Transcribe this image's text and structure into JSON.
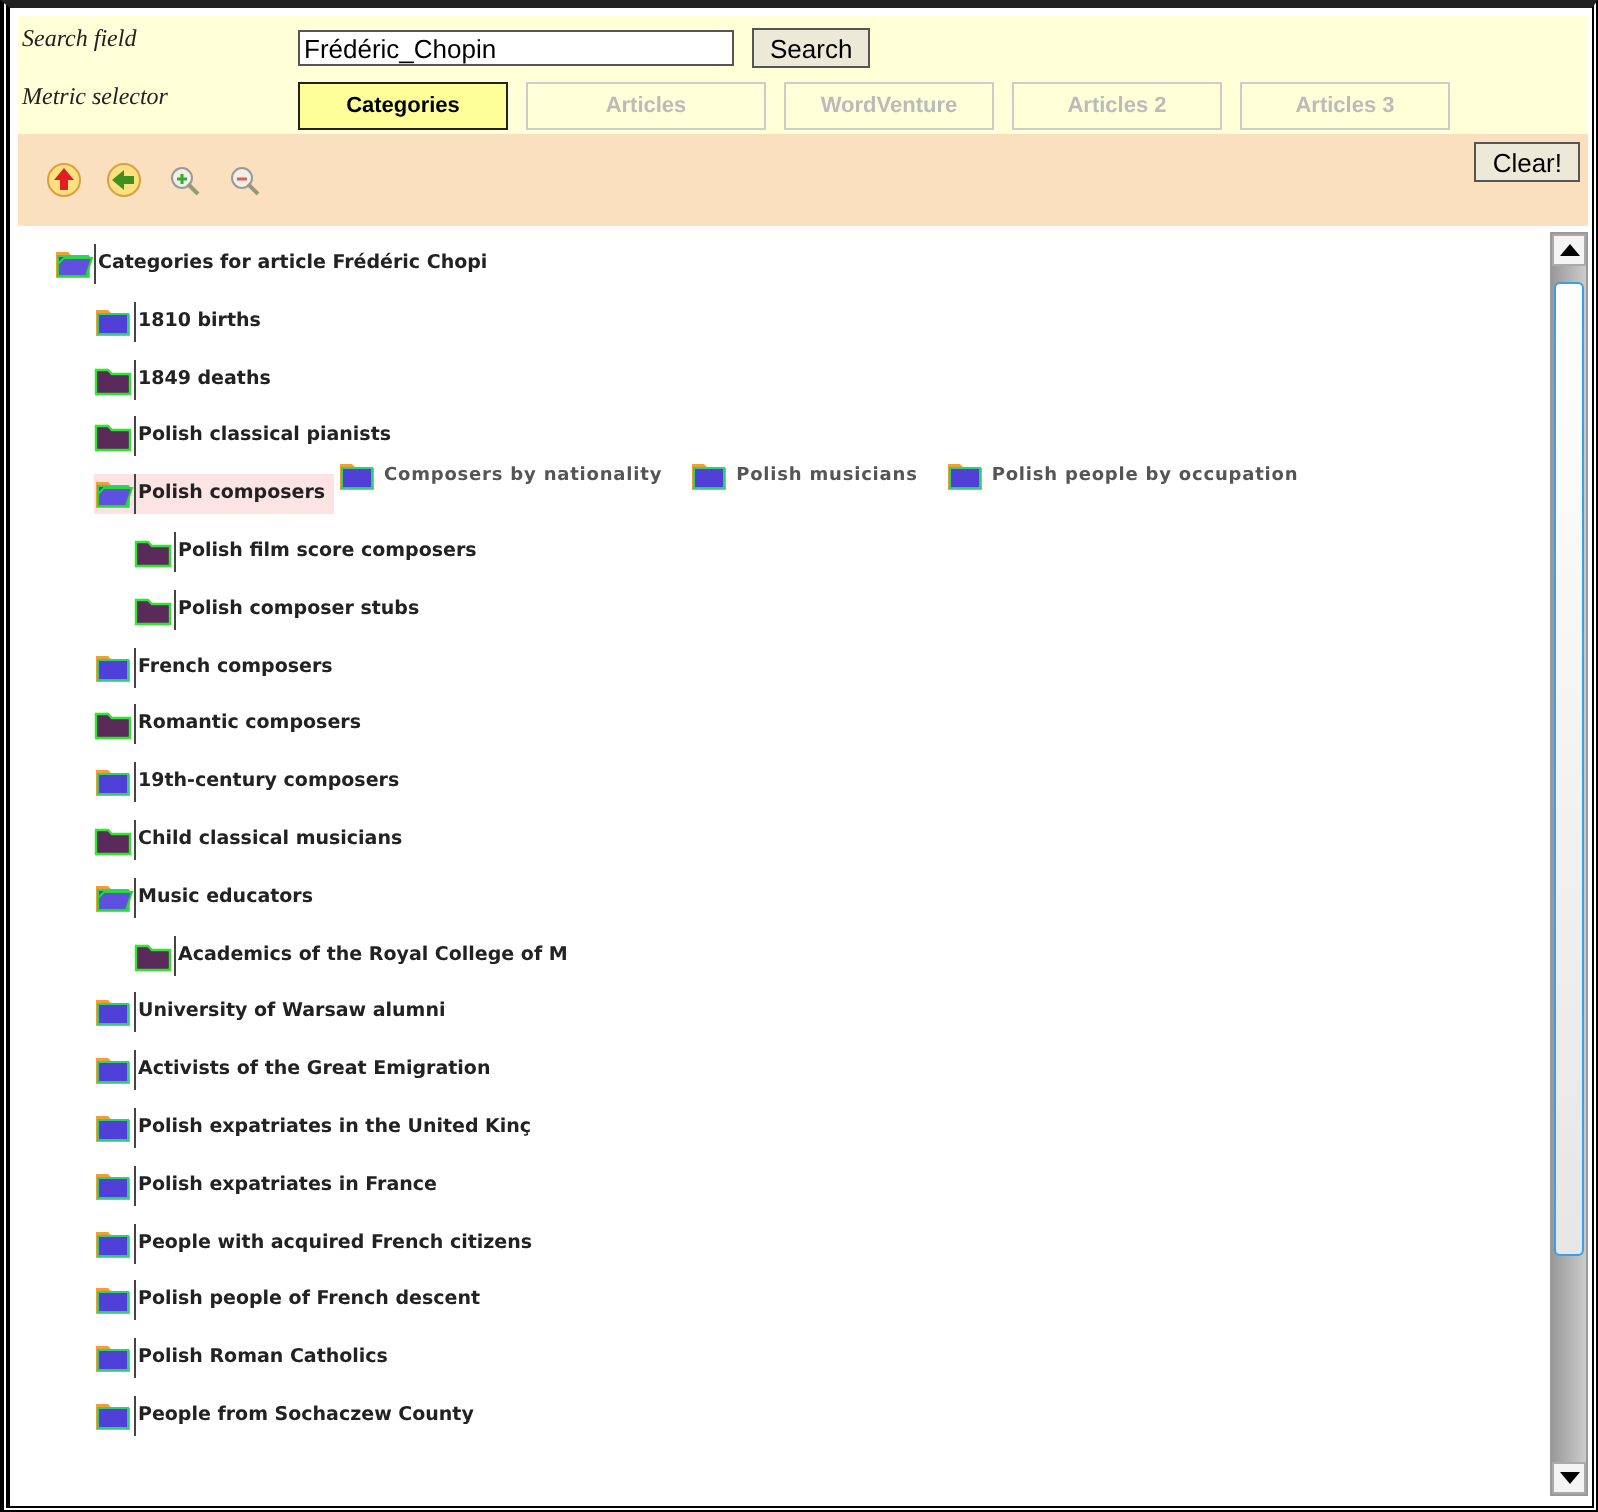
{
  "search": {
    "label": "Search field",
    "value": "Frédéric_Chopin",
    "button": "Search"
  },
  "metric": {
    "label": "Metric selector",
    "options": [
      {
        "label": "Categories",
        "selected": true
      },
      {
        "label": "Articles",
        "selected": false
      },
      {
        "label": "WordVenture",
        "selected": false
      },
      {
        "label": "Articles 2",
        "selected": false
      },
      {
        "label": "Articles 3",
        "selected": false
      }
    ]
  },
  "toolbar": {
    "clear": "Clear!"
  },
  "tree": {
    "label": "Categories for article Frédéric Chopi",
    "kind": "branch",
    "expanded": true,
    "selected": false,
    "children": [
      {
        "label": "1810 births",
        "kind": "branch",
        "expanded": false,
        "selected": false
      },
      {
        "label": "1849 deaths",
        "kind": "leaf",
        "expanded": false,
        "selected": false
      },
      {
        "label": "Polish classical pianists",
        "kind": "leaf",
        "expanded": false,
        "selected": false
      },
      {
        "label": "Polish composers",
        "kind": "branch",
        "expanded": true,
        "selected": true,
        "children": [
          {
            "label": "Polish film score composers",
            "kind": "leaf",
            "expanded": false,
            "selected": false
          },
          {
            "label": "Polish composer stubs",
            "kind": "leaf",
            "expanded": false,
            "selected": false
          }
        ]
      },
      {
        "label": "French composers",
        "kind": "branch",
        "expanded": false,
        "selected": false
      },
      {
        "label": "Romantic composers",
        "kind": "leaf",
        "expanded": false,
        "selected": false
      },
      {
        "label": "19th-century composers",
        "kind": "branch",
        "expanded": false,
        "selected": false
      },
      {
        "label": "Child classical musicians",
        "kind": "leaf",
        "expanded": false,
        "selected": false
      },
      {
        "label": "Music educators",
        "kind": "branch",
        "expanded": true,
        "selected": false,
        "children": [
          {
            "label": "Academics of the Royal College of M",
            "kind": "leaf",
            "expanded": false,
            "selected": false
          }
        ]
      },
      {
        "label": "University of Warsaw alumni",
        "kind": "branch",
        "expanded": false,
        "selected": false
      },
      {
        "label": "Activists of the Great Emigration",
        "kind": "branch",
        "expanded": false,
        "selected": false
      },
      {
        "label": "Polish expatriates in the United Kinç",
        "kind": "branch",
        "expanded": false,
        "selected": false
      },
      {
        "label": "Polish expatriates in France",
        "kind": "branch",
        "expanded": false,
        "selected": false
      },
      {
        "label": "People with acquired French citizens",
        "kind": "branch",
        "expanded": false,
        "selected": false
      },
      {
        "label": "Polish people of French descent",
        "kind": "branch",
        "expanded": false,
        "selected": false
      },
      {
        "label": "Polish Roman Catholics",
        "kind": "branch",
        "expanded": false,
        "selected": false
      },
      {
        "label": "People from Sochaczew County",
        "kind": "branch",
        "expanded": false,
        "selected": false
      }
    ]
  },
  "parent_categories": [
    {
      "label": "Composers by nationality"
    },
    {
      "label": "Polish musicians"
    },
    {
      "label": "Polish people by occupation"
    }
  ]
}
